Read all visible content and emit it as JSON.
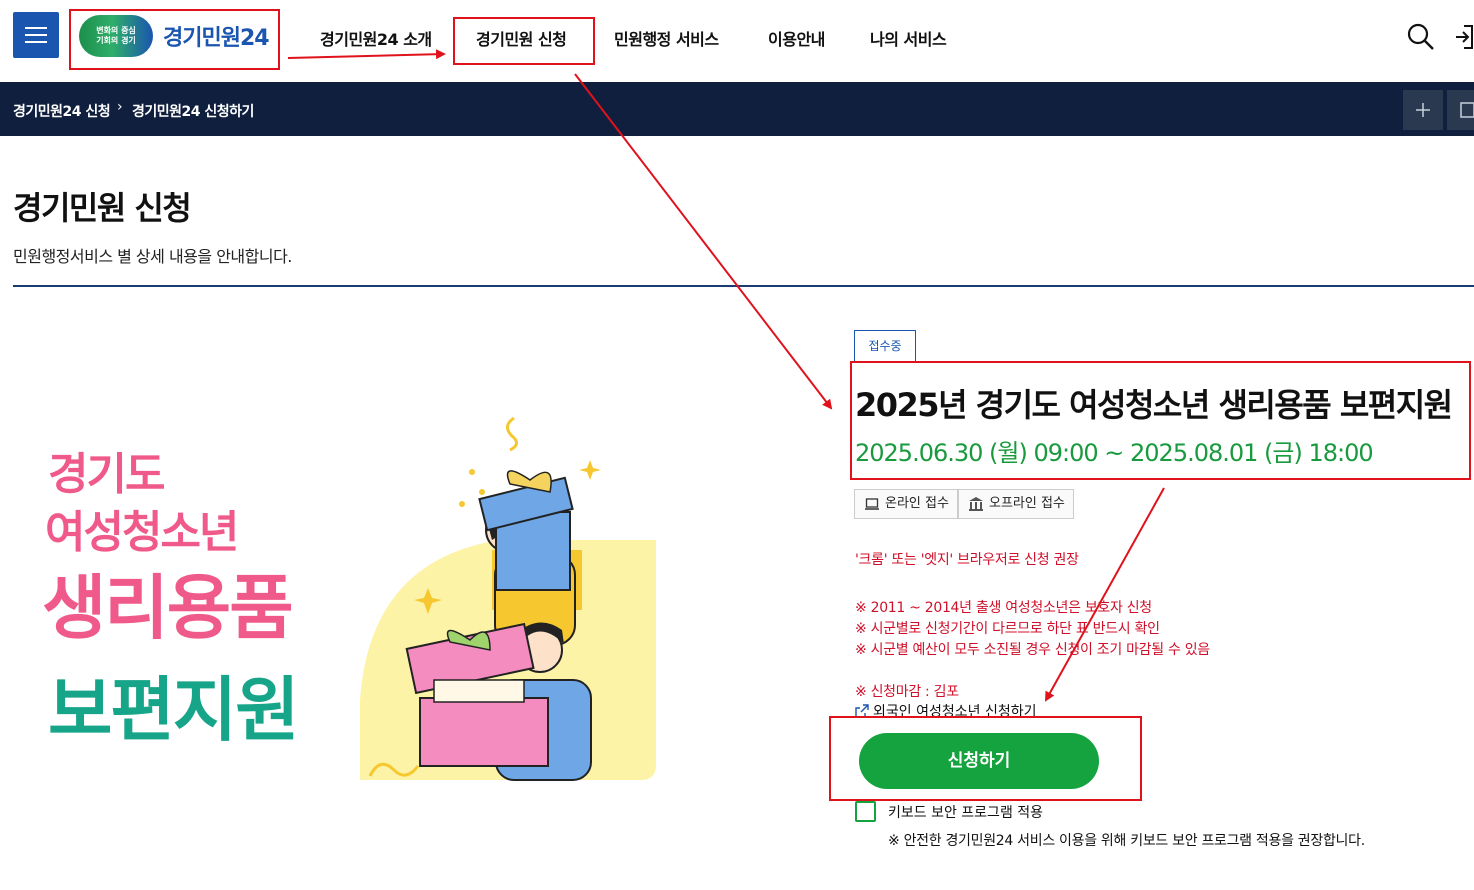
{
  "header": {
    "logo_mark_line1": "변화의 중심",
    "logo_mark_line2": "기회의 경기",
    "logo_text": "경기민원24",
    "nav": [
      "경기민원24 소개",
      "경기민원 신청",
      "민원행정 서비스",
      "이용안내",
      "나의 서비스"
    ]
  },
  "breadcrumb": [
    "경기민원24 신청",
    "경기민원24 신청하기"
  ],
  "page": {
    "title": "경기민원 신청",
    "subtitle": "민원행정서비스 별 상세 내용을 안내합니다."
  },
  "poster": {
    "lines": [
      "경기도",
      "여성청소년",
      "생리용품",
      "보편지원"
    ]
  },
  "detail": {
    "status_badge": "접수중",
    "title": "2025년 경기도 여성청소년 생리용품 보편지원",
    "period": "2025.06.30 (월) 09:00 ~ 2025.08.01 (금) 18:00",
    "chips": [
      "온라인 접수",
      "오프라인 접수"
    ],
    "browser_notice": "'크롬' 또는 '엣지' 브라우저로 신청 권장",
    "notices": [
      "※ 2011 ~ 2014년 출생 여성청소년은 보호자 신청",
      "※ 시군별로 신청기간이 다르므로 하단 표 반드시 확인",
      "※ 시군별 예산이 모두 소진될 경우 신청이 조기 마감될 수 있음"
    ],
    "deadline": "※ 신청마감 : 김포",
    "foreign_link": "외국인 여성청소년 신청하기",
    "apply_button": "신청하기",
    "keyboard_label": "키보드 보안 프로그램 적용",
    "keyboard_note": "※ 안전한 경기민원24 서비스 이용을 위해 키보드 보안 프로그램 적용을 권장합니다."
  },
  "colors": {
    "brand_blue": "#1a55b0",
    "dark_navy": "#0f1f3d",
    "green": "#15a33f",
    "notice_red": "#d0102a",
    "annotation_red": "#e0121b"
  }
}
